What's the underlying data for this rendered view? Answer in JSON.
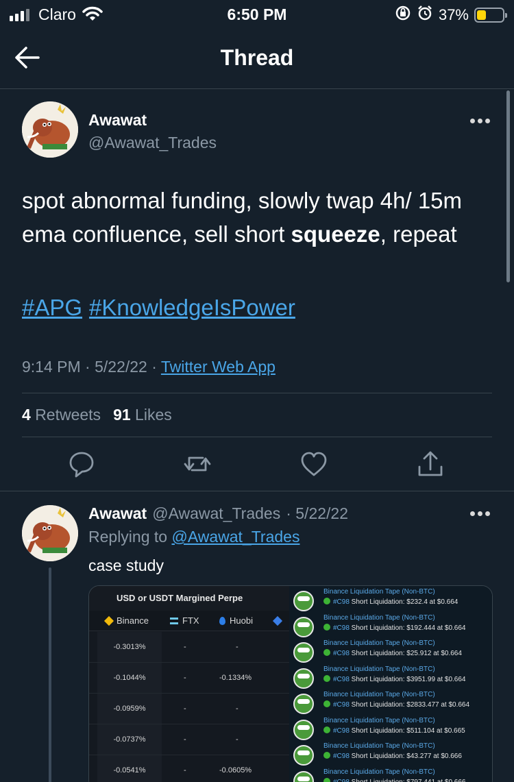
{
  "status_bar": {
    "carrier": "Claro",
    "time": "6:50 PM",
    "battery": "37%",
    "battery_level": 0.37,
    "icons": [
      "signal-icon",
      "wifi-icon",
      "rotation-lock-icon",
      "alarm-icon",
      "battery-icon"
    ]
  },
  "header": {
    "title": "Thread",
    "back_icon": "arrow-left-icon"
  },
  "tweet": {
    "author_name": "Awawat",
    "author_handle": "@Awawat_Trades",
    "text_part1": "spot abnormal funding, slowly twap 4h/ 15m ema confluence, sell short ",
    "text_bold": "squeeze",
    "text_part2": ", repeat",
    "hashtag1": "#APG",
    "hashtag2": "#KnowledgeIsPower",
    "time": "9:14 PM",
    "date": "5/22/22",
    "source": "Twitter Web App",
    "retweet_count": "4",
    "retweet_label": "Retweets",
    "like_count": "91",
    "like_label": "Likes",
    "more_icon": "more-dots-icon"
  },
  "actions": {
    "reply_icon": "reply-icon",
    "retweet_icon": "retweet-icon",
    "like_icon": "heart-icon",
    "share_icon": "share-icon"
  },
  "reply": {
    "author_name": "Awawat",
    "author_handle": "@Awawat_Trades",
    "date": "· 5/22/22",
    "replying_prefix": "Replying to",
    "replying_handle": "@Awawat_Trades",
    "text": "case study"
  },
  "media": {
    "left_title": "USD or USDT Margined Perpe",
    "exchanges": [
      "Binance",
      "FTX",
      "Huobi"
    ],
    "rows": [
      {
        "binance": "-0.3013%",
        "ftx": "-",
        "huobi": "-"
      },
      {
        "binance": "-0.1044%",
        "ftx": "-",
        "huobi": "-0.1334%"
      },
      {
        "binance": "-0.0959%",
        "ftx": "-",
        "huobi": "-"
      },
      {
        "binance": "-0.0737%",
        "ftx": "-",
        "huobi": "-"
      },
      {
        "binance": "-0.0541%",
        "ftx": "-",
        "huobi": "-0.0605%"
      }
    ],
    "liquidations": [
      {
        "title": "Binance Liquidation Tape (Non-BTC)",
        "tag": "#C98",
        "text": " Short Liquidation: $232.4 at $0.664"
      },
      {
        "title": "Binance Liquidation Tape (Non-BTC)",
        "tag": "#C98",
        "text": " Short Liquidation: $192.444 at $0.664"
      },
      {
        "title": "Binance Liquidation Tape (Non-BTC)",
        "tag": "#C98",
        "text": " Short Liquidation: $25.912 at $0.664"
      },
      {
        "title": "Binance Liquidation Tape (Non-BTC)",
        "tag": "#C98",
        "text": " Short Liquidation: $3951.99 at $0.664"
      },
      {
        "title": "Binance Liquidation Tape (Non-BTC)",
        "tag": "#C98",
        "text": " Short Liquidation: $2833.477 at $0.664"
      },
      {
        "title": "Binance Liquidation Tape (Non-BTC)",
        "tag": "#C98",
        "text": " Short Liquidation: $511.104 at $0.665"
      },
      {
        "title": "Binance Liquidation Tape (Non-BTC)",
        "tag": "#C98",
        "text": " Short Liquidation: $43.277 at $0.666"
      },
      {
        "title": "Binance Liquidation Tape (Non-BTC)",
        "tag": "#C98",
        "text": " Short Liquidation: $797.441 at $0.666"
      }
    ]
  },
  "colors": {
    "background": "#15202b",
    "link": "#4aa6e8",
    "secondary_text": "#8b98a5",
    "divider": "#38444d"
  }
}
